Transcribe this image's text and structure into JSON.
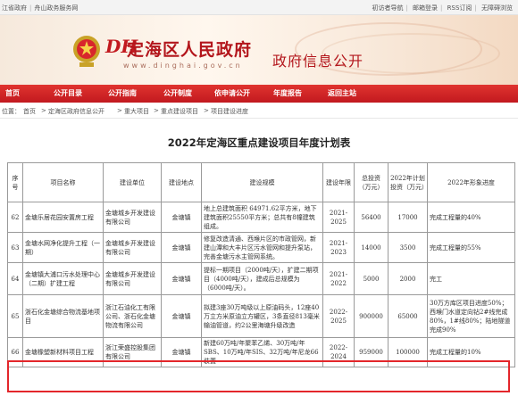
{
  "topbar": {
    "left_a": "江省政府",
    "left_b": "舟山政务服务网",
    "links": [
      "初访者导航",
      "邮箱登录",
      "RSS订阅",
      "无障碍浏览"
    ]
  },
  "header": {
    "logo_mark": "DH",
    "site_title": "定海区人民政府",
    "domain": "www.dinghai.gov.cn",
    "section_title": "政府信息公开"
  },
  "nav": {
    "items": [
      "首页",
      "公开目录",
      "公开指南",
      "公开制度",
      "依申请公开",
      "年度报告",
      "返回主站"
    ]
  },
  "breadcrumb": {
    "label": "位置：",
    "path": [
      "首页",
      "定海区政府信息公开",
      "重大项目",
      "重点建设项目",
      "项目建设进度"
    ]
  },
  "document": {
    "title": "2022年定海区重点建设项目年度计划表"
  },
  "table": {
    "headers": [
      "序号",
      "项目名称",
      "建设单位",
      "建设地点",
      "建设规模",
      "建设年限",
      "总投资（万元）",
      "2022年计划投资（万元）",
      "2022年形象进度"
    ],
    "rows": [
      {
        "no": "62",
        "name": "金塘乐居花园安置房工程",
        "unit": "金塘城乡开发建设有限公司",
        "place": "金塘镇",
        "scale": "地上总建筑面积 64971.62平方米，地下建筑面积25550平方米；总共有8幢建筑组成。",
        "years": "2021-2025",
        "total": "56400",
        "plan": "17000",
        "progress": "完成工程量的40%"
      },
      {
        "no": "63",
        "name": "金塘水网净化提升工程（一期）",
        "unit": "金塘城乡开发建设有限公司",
        "place": "金塘镇",
        "scale": "修复改造清通、西堠片区的市政管网，新建山潭和大丰片区污水管网和提升泵站，完善金塘污水主管网系统。",
        "years": "2021-2023",
        "total": "14000",
        "plan": "3500",
        "progress": "完成工程量的55%"
      },
      {
        "no": "64",
        "name": "金塘镇大浦口污水处理中心（二期）扩建工程",
        "unit": "金塘城乡开发建设有限公司",
        "place": "金塘镇",
        "scale": "提标一期项目（2000吨/天），扩建二期项目（4000吨/天），建成后总规模为（6000吨/天）。",
        "years": "2021-2022",
        "total": "5000",
        "plan": "2000",
        "progress": "完工"
      },
      {
        "no": "65",
        "name": "浙石化金塘综合物流基地项目",
        "unit": "浙江石油化工有限公司、浙石化金塘物流有限公司",
        "place": "金塘镇",
        "scale": "拟建3座30万吨级以上原油码头，12座40万立方米原油立方罐区，3条直径813毫米输油管道，约2公里海塘升级改造",
        "years": "2022-2025",
        "total": "900000",
        "plan": "65000",
        "progress": "30万方库区项目进度50%；西堠门水道定向钻2#线完成80%，1#线80%；陆地隧道完成90%"
      },
      {
        "no": "66",
        "name": "金塘橡塑新材料项目工程",
        "unit": "浙江荣盛控股集团有限公司",
        "place": "金塘镇",
        "scale": "新建60万吨/年聚苯乙烯、30万吨/年SBS、10万吨/年SIS、32万吨/年尼龙66装置",
        "years": "2022-2024",
        "total": "959000",
        "plan": "100000",
        "progress": "完成工程量的10%"
      }
    ]
  },
  "colors": {
    "brand_red": "#c2191f",
    "highlight": "#e3262b"
  }
}
